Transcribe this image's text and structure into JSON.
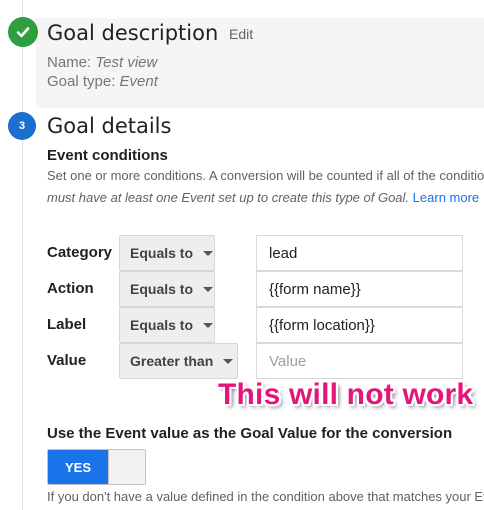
{
  "goal_description": {
    "title": "Goal description",
    "edit_label": "Edit",
    "name_label": "Name:",
    "name_value": "Test view",
    "type_label": "Goal type:",
    "type_value": "Event"
  },
  "goal_details": {
    "step_number": "3",
    "title": "Goal details",
    "section_heading": "Event conditions",
    "help_line_1": "Set one or more conditions. A conversion will be counted if all of the conditions you set are true when an Event is triggered.",
    "help_line_2": "must have at least one Event set up to create this type of Goal.",
    "learn_more_label": "Learn more"
  },
  "conditions": [
    {
      "label": "Category",
      "operator": "Equals to",
      "value": "lead",
      "placeholder": ""
    },
    {
      "label": "Action",
      "operator": "Equals to",
      "value": "{{form name}}",
      "placeholder": ""
    },
    {
      "label": "Label",
      "operator": "Equals to",
      "value": "{{form location}}",
      "placeholder": ""
    },
    {
      "label": "Value",
      "operator": "Greater than",
      "value": "",
      "placeholder": "Value"
    }
  ],
  "annotation": "This will not work",
  "event_value": {
    "heading": "Use the Event value as the Goal Value for the conversion",
    "toggle_label": "YES",
    "help_text": "If you don't have a value defined in the condition above that matches your Event value, the Goal Value will be the Event value."
  },
  "colors": {
    "complete_green": "#2e9e3e",
    "step_blue": "#1a6fd0",
    "toggle_blue": "#1a73e8",
    "annotation_pink": "#e4167a"
  },
  "icons": {
    "complete": "check-icon",
    "operator_dropdown": "caret-down-icon"
  }
}
